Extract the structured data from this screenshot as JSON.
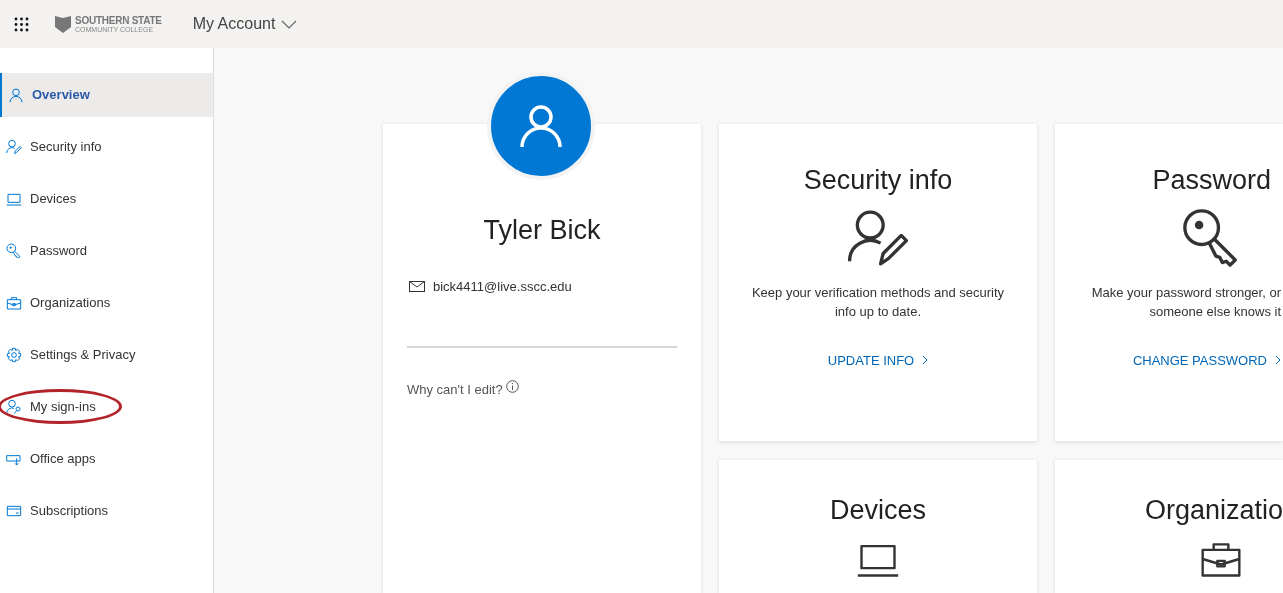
{
  "header": {
    "logo": {
      "name": "SOUTHERN STATE",
      "subtitle": "COMMUNITY COLLEGE"
    },
    "title": "My Account"
  },
  "sidebar": {
    "items": [
      {
        "label": "Overview",
        "kind": "person",
        "selected": true,
        "circled": false
      },
      {
        "label": "Security info",
        "kind": "person-pen",
        "selected": false,
        "circled": false
      },
      {
        "label": "Devices",
        "kind": "laptop",
        "selected": false,
        "circled": false
      },
      {
        "label": "Password",
        "kind": "key",
        "selected": false,
        "circled": false
      },
      {
        "label": "Organizations",
        "kind": "briefcase",
        "selected": false,
        "circled": false
      },
      {
        "label": "Settings & Privacy",
        "kind": "gear",
        "selected": false,
        "circled": false
      },
      {
        "label": "My sign-ins",
        "kind": "person-key",
        "selected": false,
        "circled": true
      },
      {
        "label": "Office apps",
        "kind": "apps",
        "selected": false,
        "circled": false
      },
      {
        "label": "Subscriptions",
        "kind": "card",
        "selected": false,
        "circled": false
      }
    ]
  },
  "profile": {
    "name": "Tyler Bick",
    "email": "bick4411@live.sscc.edu",
    "help_link": "Why can't I edit?"
  },
  "cards": [
    {
      "title": "Security info",
      "kind": "person-pen",
      "description_lines": [
        "Keep your verification methods and security",
        "info up to date."
      ],
      "link": "UPDATE INFO"
    },
    {
      "title": "Password",
      "kind": "key",
      "description_lines": [
        "Make your password stronger, or",
        "someone else knows it"
      ],
      "link": "CHANGE PASSWORD"
    },
    {
      "title": "Devices",
      "kind": "laptop"
    },
    {
      "title": "Organizatio",
      "kind": "briefcase"
    }
  ]
}
